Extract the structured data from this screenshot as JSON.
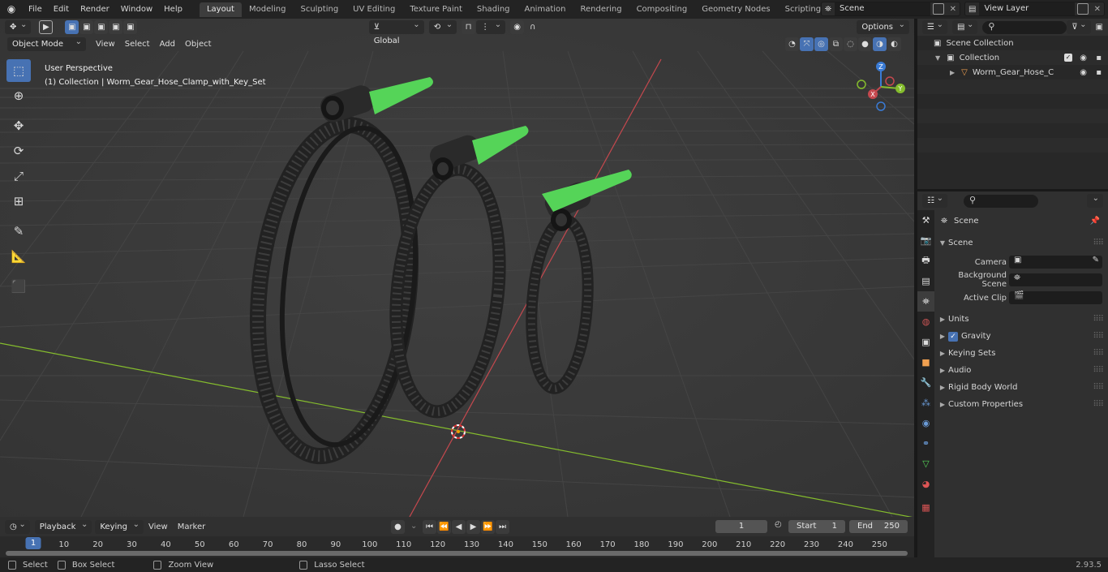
{
  "topbar": {
    "menu": [
      "File",
      "Edit",
      "Render",
      "Window",
      "Help"
    ],
    "workspaces": [
      "Layout",
      "Modeling",
      "Sculpting",
      "UV Editing",
      "Texture Paint",
      "Shading",
      "Animation",
      "Rendering",
      "Compositing",
      "Geometry Nodes",
      "Scripting"
    ],
    "active_workspace": "Layout",
    "scene": "Scene",
    "view_layer": "View Layer"
  },
  "viewport": {
    "mode": "Object Mode",
    "menus": [
      "View",
      "Select",
      "Add",
      "Object"
    ],
    "transform_orientation": "Global",
    "options": "Options",
    "info_line1": "User Perspective",
    "info_line2": "(1) Collection | Worm_Gear_Hose_Clamp_with_Key_Set",
    "gizmo_axes": {
      "z": "Z",
      "y": "Y",
      "x": "X"
    }
  },
  "outliner": {
    "rows": [
      {
        "label": "Scene Collection"
      },
      {
        "label": "Collection"
      },
      {
        "label": "Worm_Gear_Hose_Clamp"
      }
    ]
  },
  "properties": {
    "header": "Scene",
    "panel_title": "Scene",
    "fields": [
      {
        "label": "Camera"
      },
      {
        "label": "Background Scene"
      },
      {
        "label": "Active Clip"
      }
    ],
    "subpanels": [
      "Units",
      "Gravity",
      "Keying Sets",
      "Audio",
      "Rigid Body World",
      "Custom Properties"
    ]
  },
  "timeline": {
    "menus": [
      "Playback",
      "Keying",
      "View",
      "Marker"
    ],
    "current_frame": "1",
    "start_label": "Start",
    "start": "1",
    "end_label": "End",
    "end": "250",
    "ticks": [
      "10",
      "20",
      "30",
      "40",
      "50",
      "60",
      "70",
      "80",
      "90",
      "100",
      "110",
      "120",
      "130",
      "140",
      "150",
      "160",
      "170",
      "180",
      "190",
      "200",
      "210",
      "220",
      "230",
      "240",
      "250"
    ],
    "marker_frame": "1"
  },
  "statusbar": {
    "items": [
      "Select",
      "Box Select",
      "Zoom View",
      "Lasso Select"
    ],
    "version": "2.93.5"
  },
  "colors": {
    "accent": "#4772b3",
    "x_axis": "#c5484e",
    "y_axis": "#85bd2d",
    "z_axis": "#3a7bd5",
    "key_green": "#55d458"
  }
}
